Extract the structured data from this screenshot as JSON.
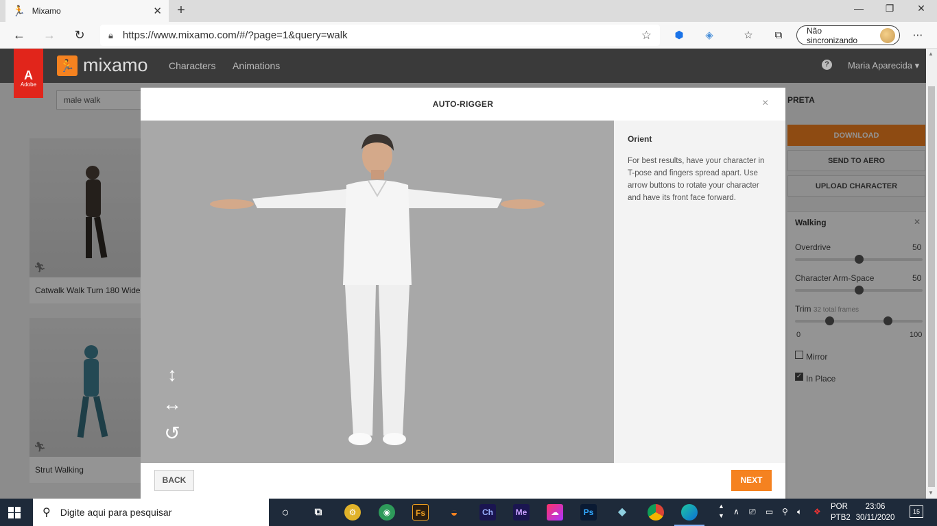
{
  "browser": {
    "tab_title": "Mixamo",
    "tab_close": "✕",
    "new_tab": "+",
    "url": "https://www.mixamo.com/#/?page=1&query=walk",
    "profile_label": "Não sincronizando",
    "window_controls": [
      "—",
      "❐",
      "✕"
    ]
  },
  "site": {
    "adobe_label": "Adobe",
    "logo_text": "mixamo",
    "nav": [
      "Characters",
      "Animations"
    ],
    "help": "?",
    "user_name": "Maria Aparecida"
  },
  "search": {
    "value": "male walk"
  },
  "cards": [
    {
      "label": "Catwalk Walk Turn 180 Wide"
    },
    {
      "label": "Strut Walking"
    }
  ],
  "right_panel": {
    "title": "PRETA",
    "download": "DOWNLOAD",
    "send_to_aero": "SEND TO AERO",
    "upload": "UPLOAD CHARACTER",
    "anim_name": "Walking",
    "close": "✕",
    "overdrive_label": "Overdrive",
    "overdrive_value": "50",
    "overdrive_level": 0.5,
    "armspace_label": "Character Arm-Space",
    "armspace_value": "50",
    "armspace_level": 0.5,
    "trim_label": "Trim",
    "trim_frames": "32 total frames",
    "trim_range": [
      0.27,
      0.73
    ],
    "trim_min": "0",
    "trim_max": "100",
    "mirror_label": "Mirror",
    "mirror_checked": false,
    "inplace_label": "In Place",
    "inplace_checked": true
  },
  "modal": {
    "title": "AUTO-RIGGER",
    "close": "×",
    "heading": "Orient",
    "description": "For best results, have your character in T-pose and fingers spread apart. Use arrow buttons to rotate your character and have its front face forward.",
    "back": "BACK",
    "next": "NEXT"
  },
  "taskbar": {
    "search_placeholder": "Digite aqui para pesquisar",
    "lang_top": "POR",
    "lang_bottom": "PTB2",
    "time": "23:06",
    "date": "30/11/2020",
    "notifications": "15",
    "apps": [
      "Fs",
      "Ch",
      "Me",
      "Ps"
    ]
  },
  "colors": {
    "accent": "#f58220",
    "topnav": "#3a3a3a",
    "adobe_red": "#e1251b",
    "viewport": "#a8a8a8"
  }
}
